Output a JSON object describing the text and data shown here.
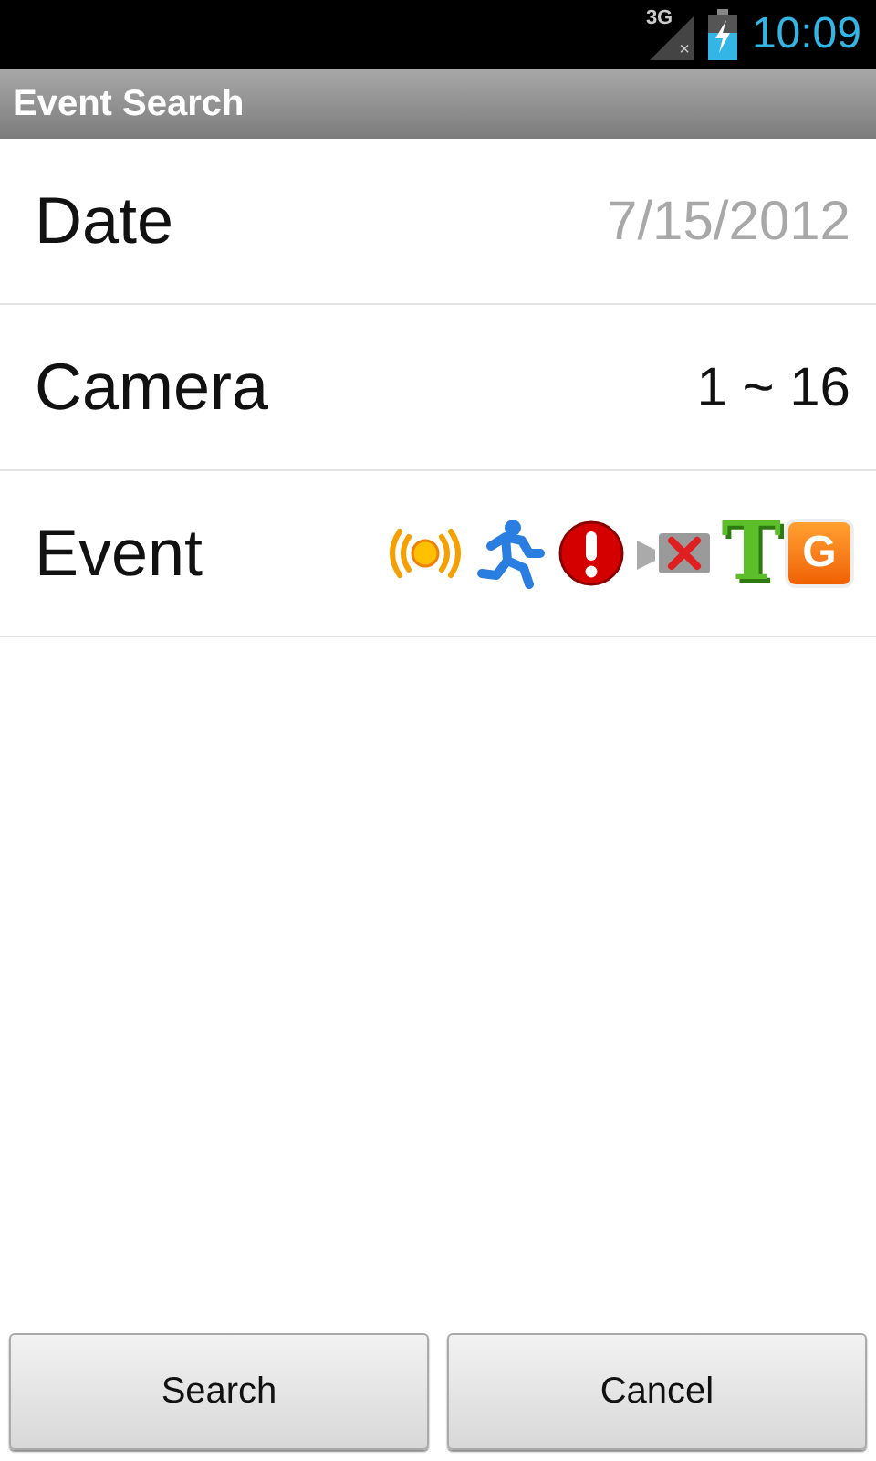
{
  "status_bar": {
    "network": "3G",
    "network_mark": "×",
    "time": "10:09"
  },
  "title": "Event Search",
  "rows": [
    {
      "label": "Date",
      "kind": "text",
      "value": "7/15/2012",
      "dimmed": true
    },
    {
      "label": "Camera",
      "kind": "text",
      "value": "1 ~ 16",
      "dimmed": false
    },
    {
      "label": "Event",
      "kind": "icons",
      "events": [
        {
          "kind": "alarm"
        },
        {
          "kind": "motion"
        },
        {
          "kind": "alert"
        },
        {
          "kind": "video-loss"
        },
        {
          "kind": "letter",
          "label": "T"
        },
        {
          "kind": "tile",
          "label": "G"
        }
      ]
    }
  ],
  "buttons": [
    "Search",
    "Cancel"
  ]
}
